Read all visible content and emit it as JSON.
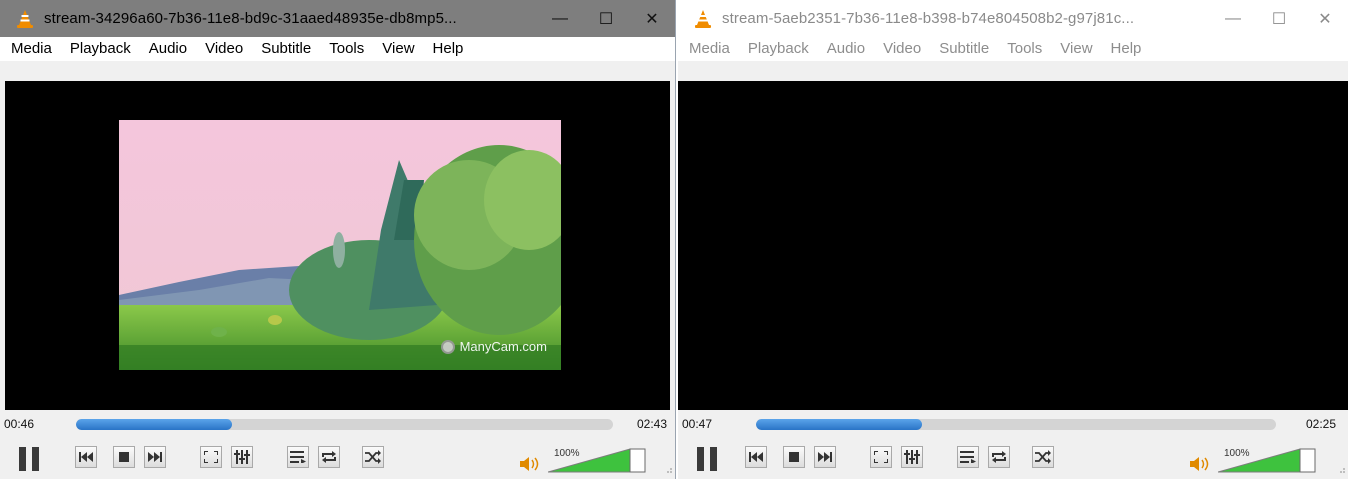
{
  "windows": [
    {
      "title": "stream-34296a60-7b36-11e8-bd9c-31aaed48935e-db8mp5...",
      "active": true,
      "caption": {
        "minimize": "—",
        "maximize": "☐",
        "close": "✕"
      },
      "menu": [
        "Media",
        "Playback",
        "Audio",
        "Video",
        "Subtitle",
        "Tools",
        "View",
        "Help"
      ],
      "video": {
        "watermark": "ManyCam.com",
        "showing_frame": true
      },
      "elapsed": "00:46",
      "remaining": "02:43",
      "progress": 0.29,
      "volume_label": "100%",
      "volume": 1.0
    },
    {
      "title": "stream-5aeb2351-7b36-11e8-b398-b74e804508b2-g97j81c...",
      "active": false,
      "caption": {
        "minimize": "—",
        "maximize": "☐",
        "close": "✕"
      },
      "menu": [
        "Media",
        "Playback",
        "Audio",
        "Video",
        "Subtitle",
        "Tools",
        "View",
        "Help"
      ],
      "video": {
        "watermark": "",
        "showing_frame": false
      },
      "elapsed": "00:47",
      "remaining": "02:25",
      "progress": 0.32,
      "volume_label": "100%",
      "volume": 1.0
    }
  ],
  "icons": {
    "app": "vlc-cone-icon",
    "controls": [
      "pause-icon",
      "previous-icon",
      "stop-icon",
      "next-icon",
      "fullscreen-icon",
      "extended-settings-icon",
      "playlist-icon",
      "loop-icon",
      "shuffle-icon",
      "speaker-icon"
    ]
  },
  "colors": {
    "seek_fill": "#2a74c6",
    "volume_fill": "#3ec23e",
    "active_titlebar": "#7e7e7e",
    "inactive_titlebar": "#ffffff"
  }
}
